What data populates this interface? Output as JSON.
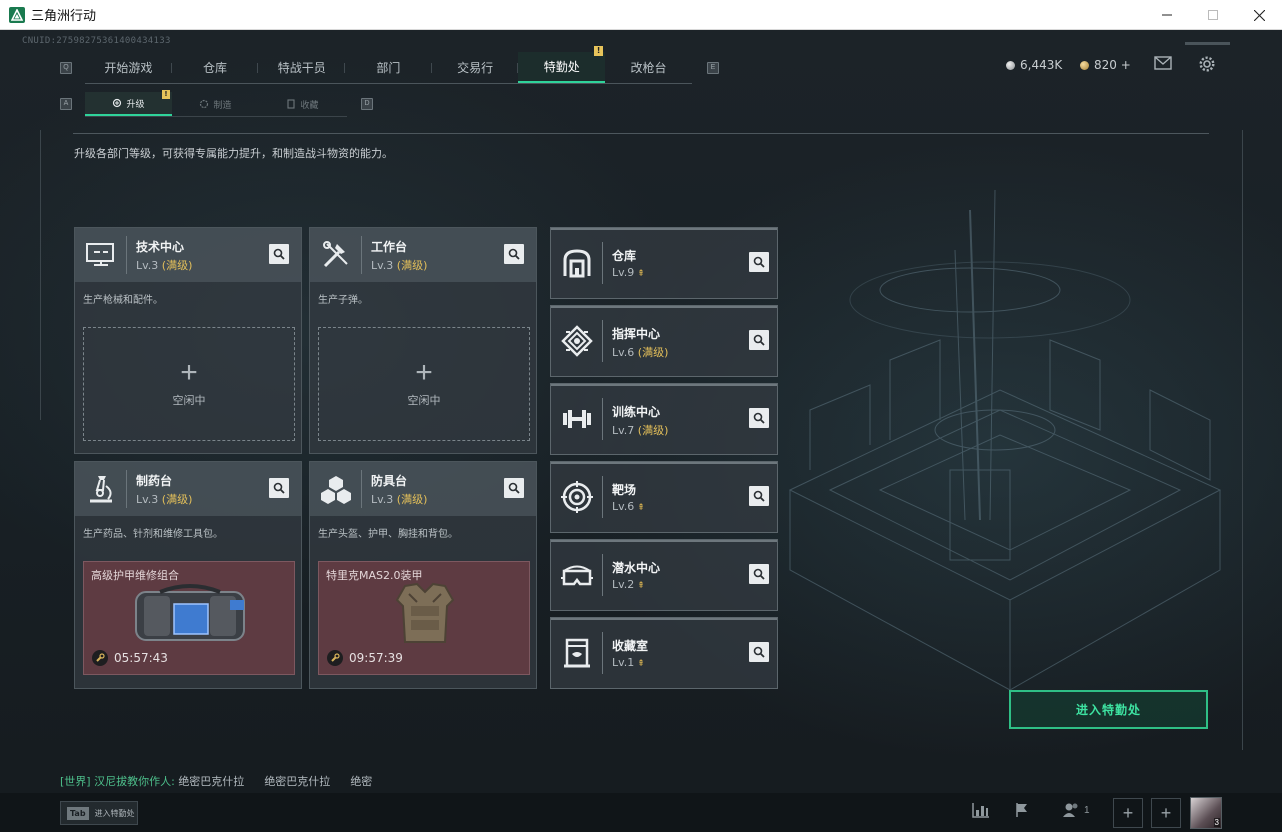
{
  "window": {
    "title": "三角洲行动",
    "controls": [
      "minimize",
      "maximize",
      "close"
    ]
  },
  "account": {
    "cnuid": "CNUID:2759827536140043413​3"
  },
  "nav": {
    "left_key": "Q",
    "right_key": "E",
    "tabs": [
      {
        "label": "开始游戏"
      },
      {
        "label": "仓库"
      },
      {
        "label": "特战干员"
      },
      {
        "label": "部门"
      },
      {
        "label": "交易行"
      },
      {
        "label": "特勤处",
        "active": true,
        "badge": "!"
      },
      {
        "label": "改枪台"
      }
    ]
  },
  "currency": {
    "silver": "6,443K",
    "gold": "820 +"
  },
  "icons": {
    "mail": "mail-icon",
    "settings": "gear-icon"
  },
  "subnav": {
    "left_key": "A",
    "right_key": "D",
    "tabs": [
      {
        "label": "升级",
        "active": true,
        "badge": "!"
      },
      {
        "label": "制造"
      },
      {
        "label": "收藏"
      }
    ]
  },
  "description": "升级各部门等级，可获得专属能力提升，和制造战斗物资的能力。",
  "workshops": [
    {
      "name": "技术中心",
      "lv": "Lv.3",
      "status": "(满级)",
      "sub": "生产枪械和配件。",
      "slot": {
        "state": "idle",
        "label": "空闲中",
        "plus": "+"
      },
      "icon": "monitor-icon"
    },
    {
      "name": "工作台",
      "lv": "Lv.3",
      "status": "(满级)",
      "sub": "生产子弹。",
      "slot": {
        "state": "idle",
        "label": "空闲中",
        "plus": "+"
      },
      "icon": "tools-icon"
    },
    {
      "name": "制药台",
      "lv": "Lv.3",
      "status": "(满级)",
      "sub": "生产药品、针剂和维修工具包。",
      "slot": {
        "state": "producing",
        "item": "高级护甲维修组合",
        "timer": "05:57:43"
      },
      "icon": "microscope-icon"
    },
    {
      "name": "防具台",
      "lv": "Lv.3",
      "status": "(满级)",
      "sub": "生产头盔、护甲、胸挂和背包。",
      "slot": {
        "state": "producing",
        "item": "特里克MAS2.0装甲",
        "timer": "09:57:39"
      },
      "icon": "cubes-icon"
    }
  ],
  "facilities": [
    {
      "name": "仓库",
      "lv": "Lv.9",
      "status": "",
      "upgradable": true,
      "icon": "warehouse-icon"
    },
    {
      "name": "指挥中心",
      "lv": "Lv.6",
      "status": "(满级)",
      "upgradable": false,
      "icon": "command-icon"
    },
    {
      "name": "训练中心",
      "lv": "Lv.7",
      "status": "(满级)",
      "upgradable": false,
      "icon": "dumbbell-icon"
    },
    {
      "name": "靶场",
      "lv": "Lv.6",
      "status": "",
      "upgradable": true,
      "icon": "target-icon"
    },
    {
      "name": "潜水中心",
      "lv": "Lv.2",
      "status": "",
      "upgradable": true,
      "icon": "goggles-icon"
    },
    {
      "name": "收藏室",
      "lv": "Lv.1",
      "status": "",
      "upgradable": true,
      "icon": "collection-icon"
    }
  ],
  "enter_button": "进入特勤处",
  "chat": {
    "channel": "[世界]",
    "sender": "汉尼拔教你作人:",
    "messages": [
      "绝密巴克什拉",
      "绝密巴克什拉",
      "绝密"
    ]
  },
  "bottom": {
    "tab_key": "Tab",
    "tab_label": "进入特勤处",
    "friends_count": "1",
    "avatar_level": "3"
  },
  "colors": {
    "accent": "#2fd39a",
    "maxed": "#e3bf5a",
    "producing_bg": "#5e3b42",
    "badge": "#e7c45b"
  }
}
